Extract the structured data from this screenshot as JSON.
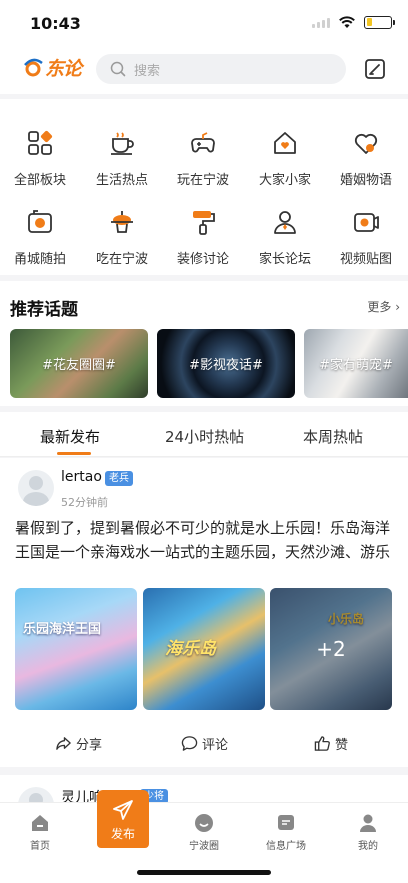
{
  "status": {
    "time": "10:43",
    "battery_level": 0.2
  },
  "app": {
    "logo_text": "东论",
    "search_placeholder": "搜索"
  },
  "categories": [
    {
      "label": "全部板块",
      "icon": "grid-icon"
    },
    {
      "label": "生活热点",
      "icon": "coffee-cup-icon"
    },
    {
      "label": "玩在宁波",
      "icon": "gamepad-icon"
    },
    {
      "label": "大家小家",
      "icon": "house-heart-icon"
    },
    {
      "label": "婚姻物语",
      "icon": "heart-icon"
    },
    {
      "label": "甬城随拍",
      "icon": "camera-icon"
    },
    {
      "label": "吃在宁波",
      "icon": "food-plate-icon"
    },
    {
      "label": "装修讨论",
      "icon": "paint-roller-icon"
    },
    {
      "label": "家长论坛",
      "icon": "person-icon"
    },
    {
      "label": "视频贴图",
      "icon": "video-icon"
    }
  ],
  "topics": {
    "title": "推荐话题",
    "more_label": "更多",
    "items": [
      "#花友圈圈#",
      "#影视夜话#",
      "#家有萌宠#"
    ]
  },
  "feed_tabs": [
    "最新发布",
    "24小时热帖",
    "本周热帖"
  ],
  "post": {
    "username": "lertao",
    "badge": "老兵",
    "time": "52分钟前",
    "text": "暑假到了，提到暑假必不可少的就是水上乐园！乐岛海洋王国是一个亲海戏水一站式的主题乐园，天然沙滩、游乐",
    "photo_captions": [
      "乐园海洋王国",
      "海乐岛",
      "小乐岛"
    ],
    "more_photos": "+2",
    "actions": {
      "share": "分享",
      "comment": "评论",
      "like": "赞"
    }
  },
  "post2": {
    "username": "灵儿响ㄊ叮",
    "badge": "少将"
  },
  "tabbar": [
    {
      "label": "首页",
      "icon": "home-icon"
    },
    {
      "label": "发布",
      "icon": "paper-plane-icon"
    },
    {
      "label": "宁波圈",
      "icon": "smile-icon"
    },
    {
      "label": "信息广场",
      "icon": "message-square-icon"
    },
    {
      "label": "我的",
      "icon": "user-icon"
    }
  ],
  "colors": {
    "accent": "#f07c18",
    "badge": "#4a90e2"
  }
}
